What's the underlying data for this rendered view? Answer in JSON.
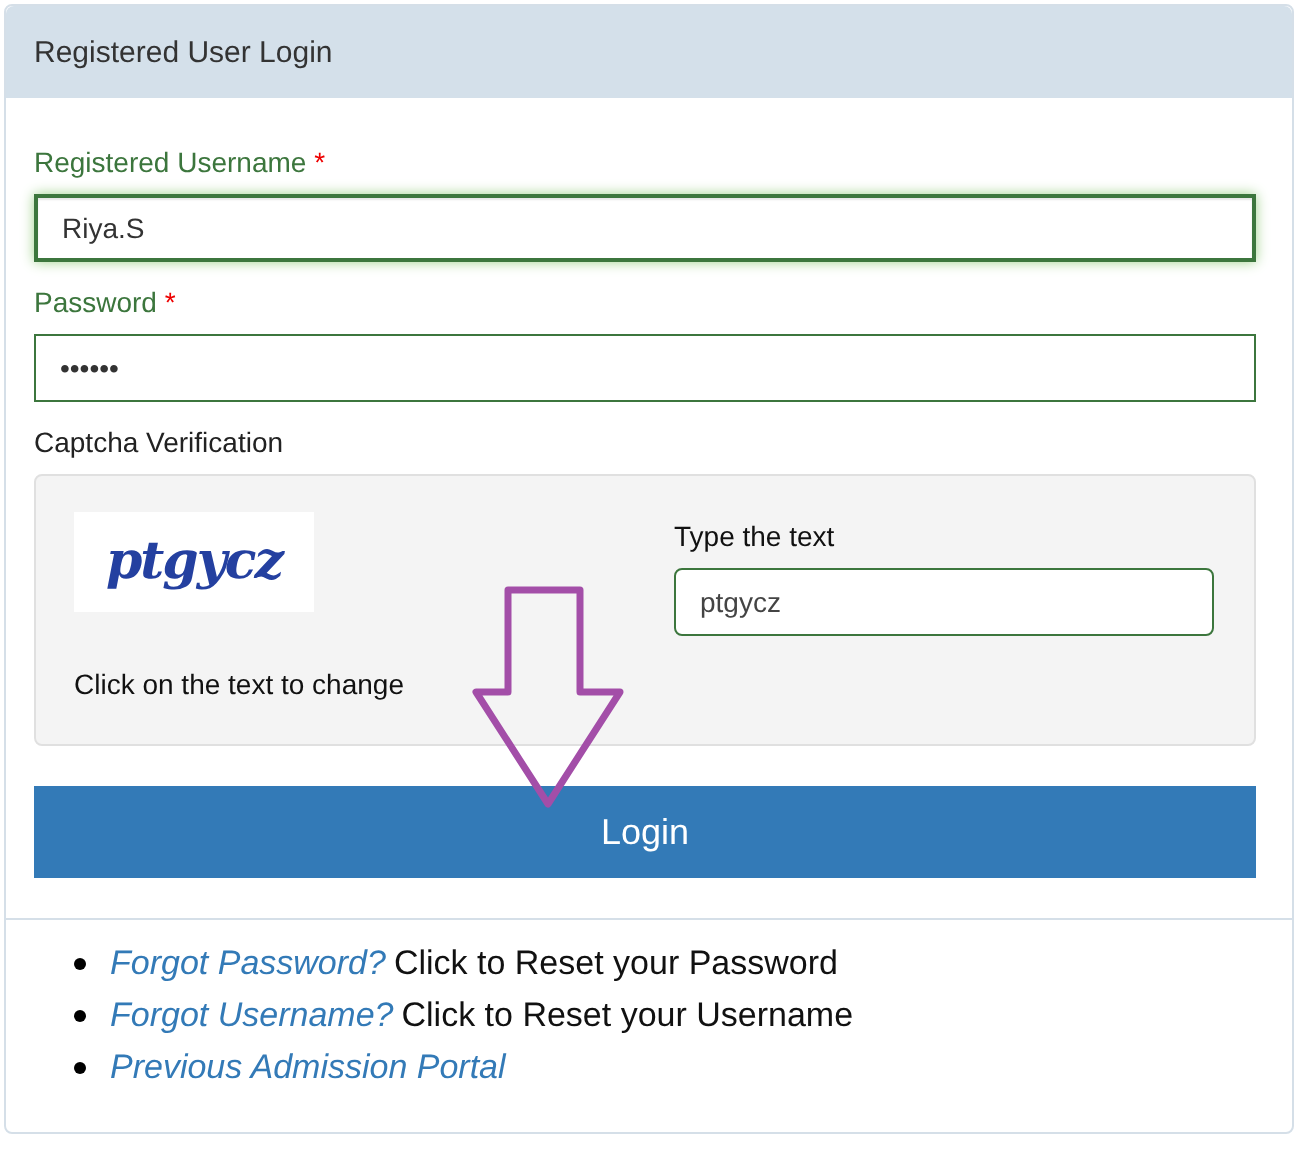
{
  "panel": {
    "title": "Registered User Login"
  },
  "fields": [
    {
      "label": "Registered Username",
      "required_mark": "*",
      "value": "Riya.S",
      "focused": true
    },
    {
      "label": "Password",
      "required_mark": "*",
      "value": "••••••",
      "focused": false
    }
  ],
  "captcha": {
    "label": "Captcha Verification",
    "image_text": "ptgycz",
    "hint": "Click on the text to change",
    "input_label": "Type the text",
    "input_value": "ptgycz"
  },
  "login_button": "Login",
  "links": [
    {
      "link": "Forgot Password?",
      "text": "Click to Reset your Password"
    },
    {
      "link": "Forgot Username?",
      "text": "Click to Reset your Username"
    },
    {
      "link": "Previous Admission Portal"
    }
  ]
}
